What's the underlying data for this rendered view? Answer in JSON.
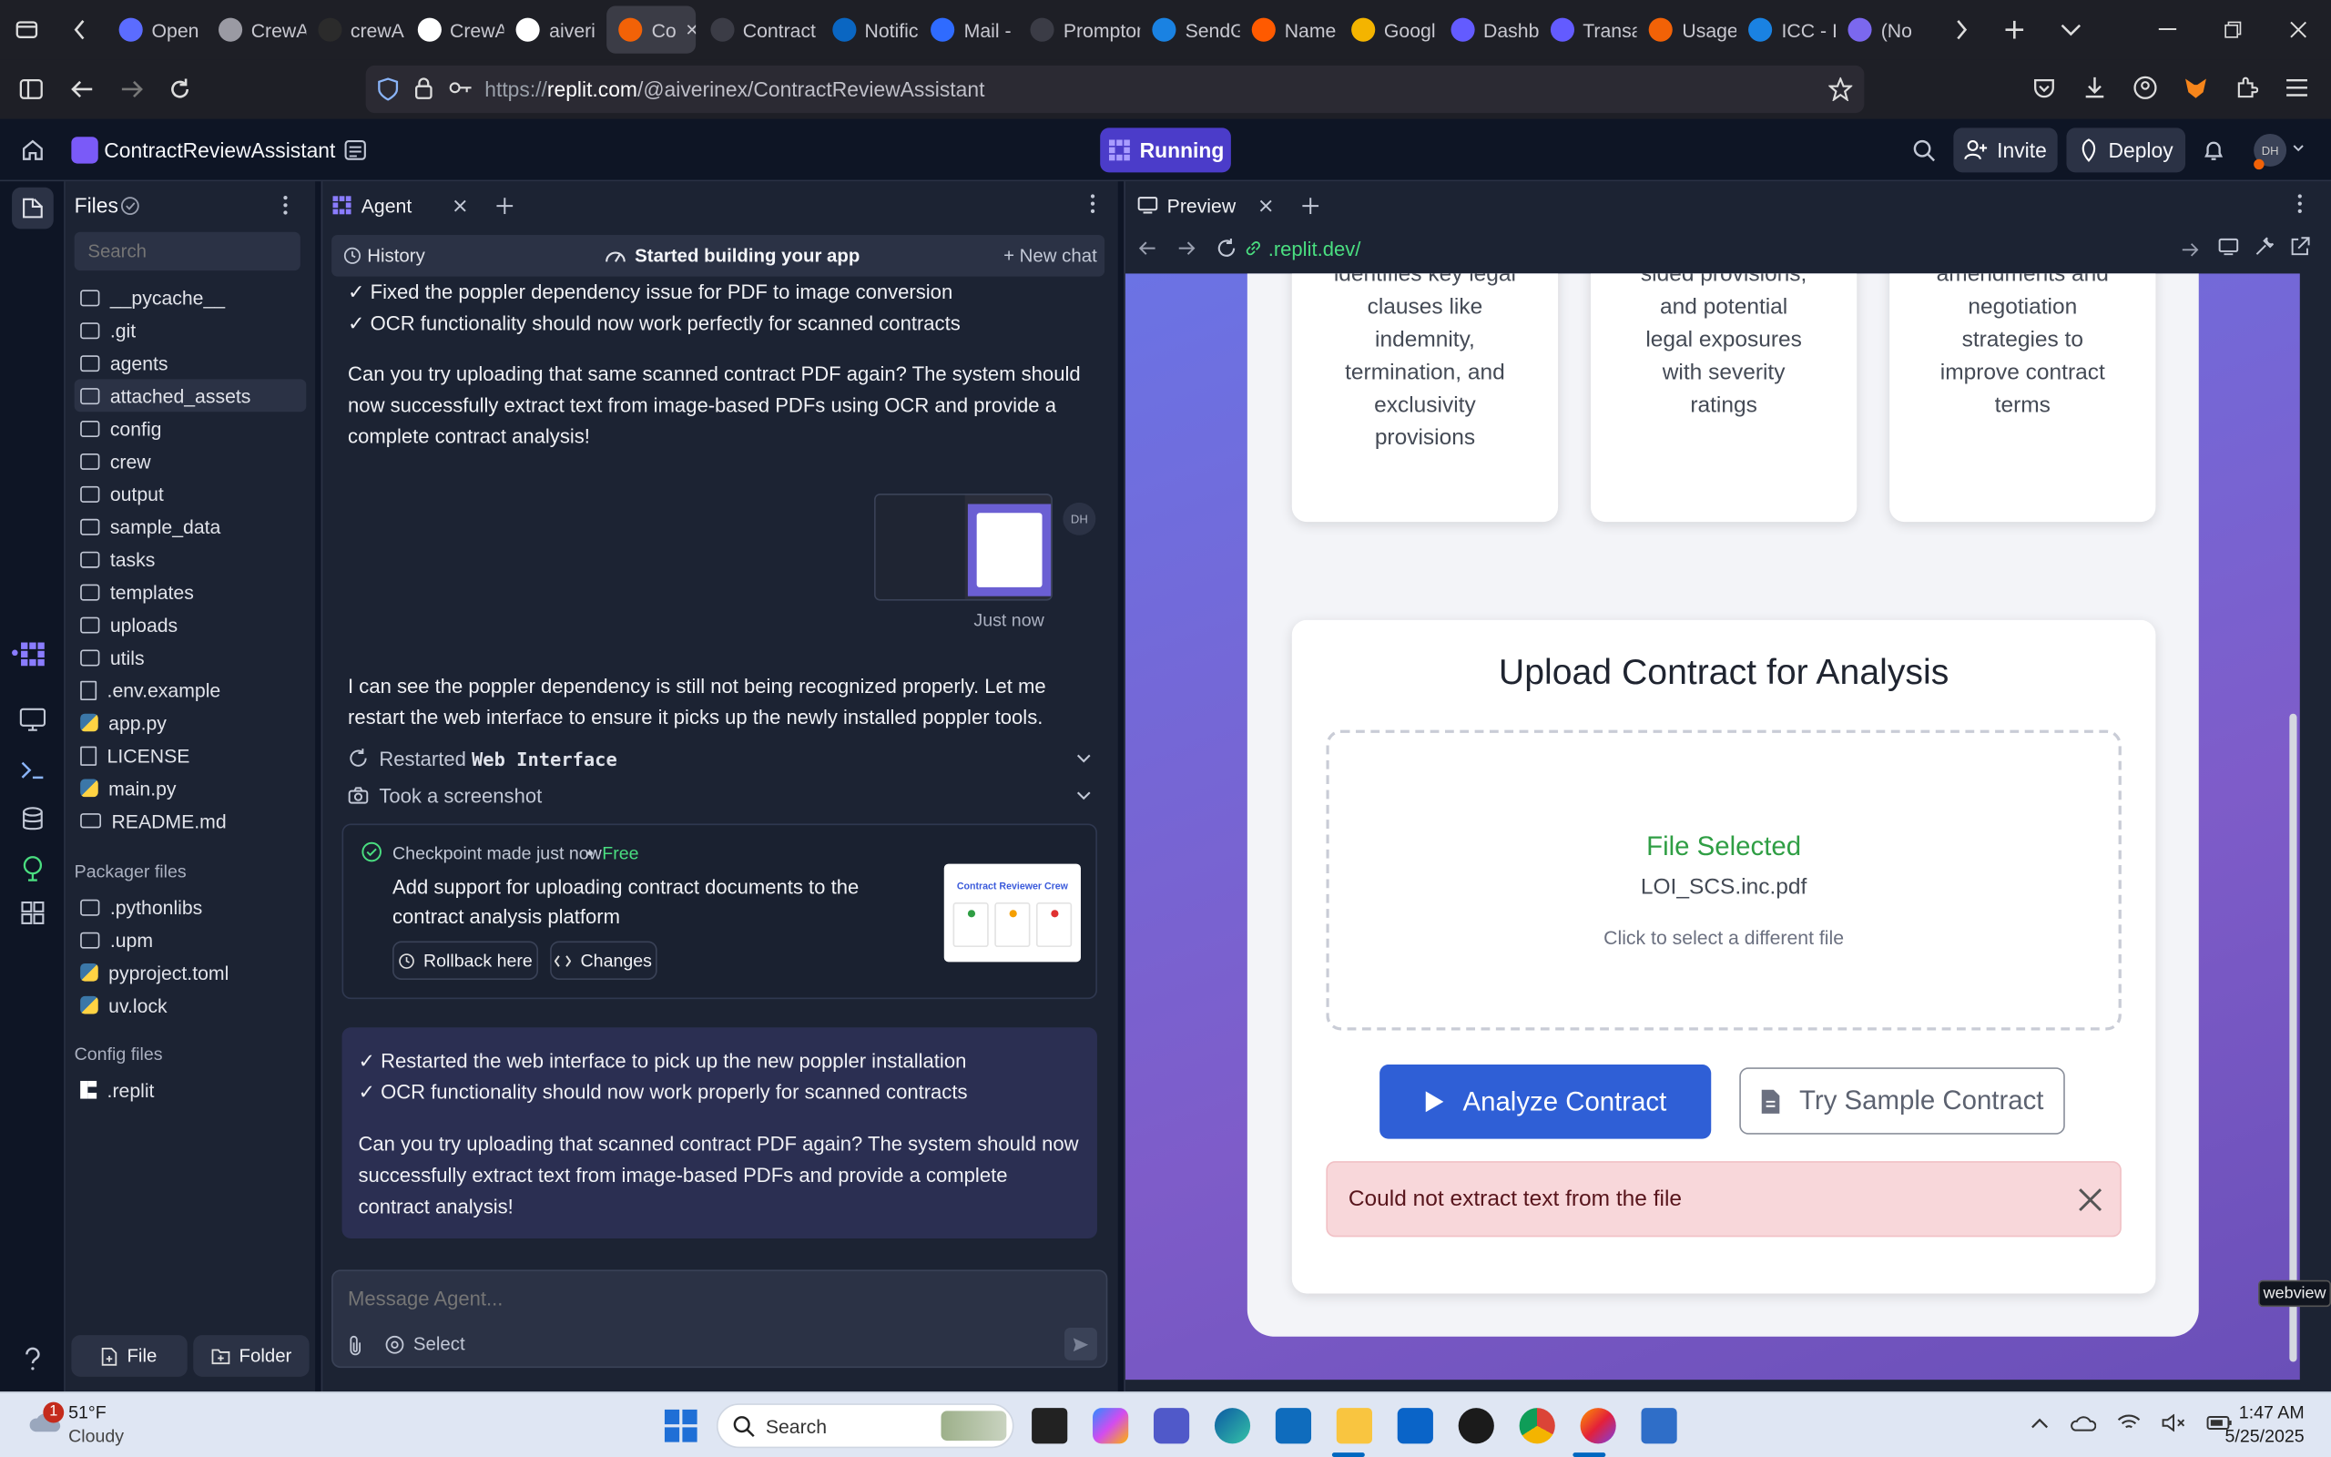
{
  "browser": {
    "tabs": [
      {
        "label": "Open",
        "color": "#5b6cff"
      },
      {
        "label": "CrewA",
        "color": "#9a9aa3"
      },
      {
        "label": "crewA",
        "color": "#2b2b2b"
      },
      {
        "label": "CrewA",
        "color": "#ffffff"
      },
      {
        "label": "aiveri",
        "color": "#ffffff"
      },
      {
        "label": "Co",
        "color": "#f26207",
        "active": true
      },
      {
        "label": "Contract R",
        "color": "#3b3c46"
      },
      {
        "label": "Notific",
        "color": "#0a66c2"
      },
      {
        "label": "Mail -",
        "color": "#2f6bff"
      },
      {
        "label": "Prompton",
        "color": "#3b3c46"
      },
      {
        "label": "SendG",
        "color": "#1a82e2"
      },
      {
        "label": "Name",
        "color": "#ff5a00"
      },
      {
        "label": "Googl",
        "color": "#f4b400"
      },
      {
        "label": "Dashb",
        "color": "#635bff"
      },
      {
        "label": "Transa",
        "color": "#635bff"
      },
      {
        "label": "Usage",
        "color": "#f26207"
      },
      {
        "label": "ICC - I",
        "color": "#1a82e2"
      },
      {
        "label": "(No",
        "color": "#7b68ee"
      }
    ],
    "url_prefix": "https://",
    "url_domain": "replit.com",
    "url_path": "/@aiverinex/ContractReviewAssistant"
  },
  "replit": {
    "project": "ContractReviewAssistant",
    "status": "Running",
    "invite": "Invite",
    "deploy": "Deploy",
    "avatar": "DH"
  },
  "files": {
    "title": "Files",
    "search_placeholder": "Search",
    "items": [
      {
        "name": "__pycache__",
        "type": "folder"
      },
      {
        "name": ".git",
        "type": "folder"
      },
      {
        "name": "agents",
        "type": "folder"
      },
      {
        "name": "attached_assets",
        "type": "folder",
        "selected": true
      },
      {
        "name": "config",
        "type": "folder"
      },
      {
        "name": "crew",
        "type": "folder"
      },
      {
        "name": "output",
        "type": "folder"
      },
      {
        "name": "sample_data",
        "type": "folder"
      },
      {
        "name": "tasks",
        "type": "folder"
      },
      {
        "name": "templates",
        "type": "folder"
      },
      {
        "name": "uploads",
        "type": "folder"
      },
      {
        "name": "utils",
        "type": "folder"
      },
      {
        "name": ".env.example",
        "type": "file"
      },
      {
        "name": "app.py",
        "type": "py"
      },
      {
        "name": "LICENSE",
        "type": "file"
      },
      {
        "name": "main.py",
        "type": "py"
      },
      {
        "name": "README.md",
        "type": "md"
      }
    ],
    "packager_title": "Packager files",
    "packager": [
      {
        "name": ".pythonlibs",
        "type": "folder"
      },
      {
        "name": ".upm",
        "type": "folder"
      },
      {
        "name": "pyproject.toml",
        "type": "py"
      },
      {
        "name": "uv.lock",
        "type": "py"
      }
    ],
    "config_title": "Config files",
    "config": [
      {
        "name": ".replit",
        "type": "replit"
      }
    ],
    "new_file": "File",
    "new_folder": "Folder"
  },
  "agent": {
    "tab": "Agent",
    "history": "History",
    "status": "Started building your app",
    "new_chat": "New chat",
    "msg1_lines": [
      "✓ Fixed the poppler dependency issue for PDF to image conversion",
      "✓ OCR functionality should now work perfectly for scanned contracts"
    ],
    "msg1_para": "Can you try uploading that same scanned contract PDF again? The system should now successfully extract text from image-based PDFs using OCR and provide a complete contract analysis!",
    "user_avatar": "DH",
    "user_time": "Just now",
    "msg2": "I can see the poppler dependency is still not being recognized properly. Let me restart the web interface to ensure it picks up the newly installed poppler tools.",
    "action1_prefix": "Restarted ",
    "action1_code": "Web Interface",
    "action2": "Took a screenshot",
    "checkpoint_title": "Checkpoint made just now",
    "checkpoint_free": "Free",
    "checkpoint_desc": "Add support for uploading contract documents to the contract analysis platform",
    "rollback": "Rollback here",
    "changes": "Changes",
    "thumb_title": "Contract Reviewer Crew",
    "msg3_lines": [
      "✓ Restarted the web interface to pick up the new poppler installation",
      "✓ OCR functionality should now work properly for scanned contracts"
    ],
    "msg3_para": "Can you try uploading that scanned contract PDF again? The system should now successfully extract text from image-based PDFs and provide a complete contract analysis!",
    "input_placeholder": "Message Agent...",
    "select": "Select"
  },
  "preview": {
    "tab": "Preview",
    "url": ".replit.dev/",
    "card1": [
      "identifies key legal",
      "clauses like",
      "indemnity,",
      "termination, and",
      "exclusivity",
      "provisions"
    ],
    "card2": [
      "sided provisions,",
      "and potential",
      "legal exposures",
      "with severity",
      "ratings"
    ],
    "card3": [
      "amendments and",
      "negotiation",
      "strategies to",
      "improve contract",
      "terms"
    ],
    "upload_title": "Upload Contract for Analysis",
    "file_selected": "File Selected",
    "file_name": "LOI_SCS.inc.pdf",
    "click_hint": "Click to select a different file",
    "analyze": "Analyze Contract",
    "sample": "Try Sample Contract",
    "error": "Could not extract text from the file",
    "tooltip": "webview"
  },
  "taskbar": {
    "temp": "51°F",
    "weather": "Cloudy",
    "badge": "1",
    "search": "Search",
    "time": "1:47 AM",
    "date": "5/25/2025"
  }
}
